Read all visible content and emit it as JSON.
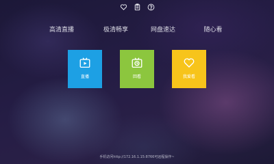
{
  "top_icons": [
    "heart-icon",
    "clipboard-icon",
    "help-icon"
  ],
  "nav": {
    "items": [
      {
        "label": "高清直播"
      },
      {
        "label": "极清畅享"
      },
      {
        "label": "网盘速达"
      },
      {
        "label": "随心看"
      }
    ]
  },
  "tiles": [
    {
      "label": "直播",
      "icon": "tv-play-icon",
      "color": "#1da0e4"
    },
    {
      "label": "回看",
      "icon": "tv-clock-icon",
      "color": "#8cc63e"
    },
    {
      "label": "我爱看",
      "icon": "heart-icon",
      "color": "#f7c41b"
    }
  ],
  "footer": {
    "text": "手机访问http://172.16.1.15:8766可远程操作~"
  }
}
